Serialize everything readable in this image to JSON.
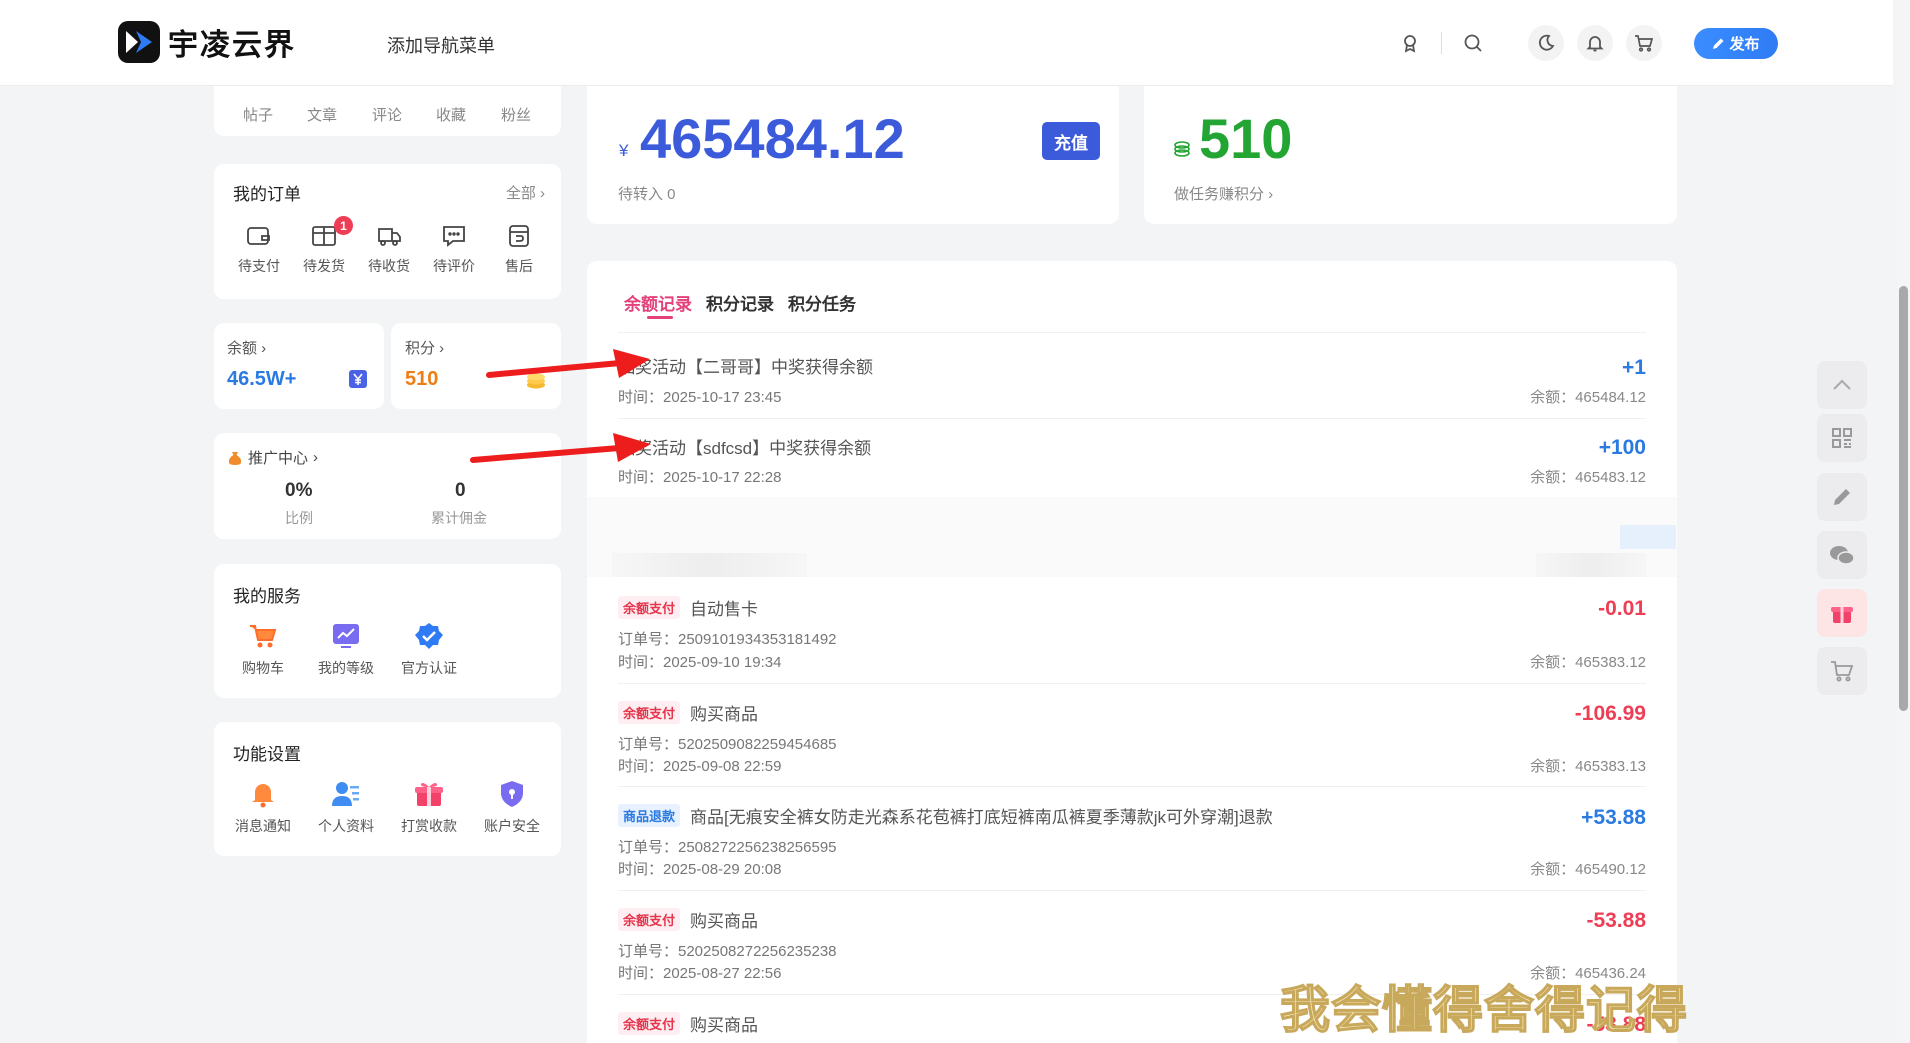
{
  "header": {
    "logo_text": "宇凌云界",
    "nav_add": "添加导航菜单",
    "publish": "发布"
  },
  "profile_stats": [
    "帖子",
    "文章",
    "评论",
    "收藏",
    "粉丝"
  ],
  "orders": {
    "title": "我的订单",
    "all": "全部",
    "badge": "1",
    "items": [
      "待支付",
      "待发货",
      "待收货",
      "待评价",
      "售后"
    ]
  },
  "mini": {
    "balance_label": "余额",
    "balance_value": "46.5W+",
    "points_label": "积分",
    "points_value": "510"
  },
  "promo": {
    "title": "推广中心",
    "ratio_value": "0%",
    "ratio_label": "比例",
    "commission_value": "0",
    "commission_label": "累计佣金"
  },
  "services": {
    "title": "我的服务",
    "items": [
      "购物车",
      "我的等级",
      "官方认证"
    ]
  },
  "settings": {
    "title": "功能设置",
    "items": [
      "消息通知",
      "个人资料",
      "打赏收款",
      "账户安全"
    ]
  },
  "balance_card": {
    "currency": "¥",
    "amount": "465484.12",
    "recharge": "充值",
    "pending": "待转入 0"
  },
  "points_card": {
    "amount": "510",
    "task_link": "做任务赚积分"
  },
  "tabs": [
    "余额记录",
    "积分记录",
    "积分任务"
  ],
  "records": [
    {
      "tag": "",
      "title": "抽奖活动【二哥哥】中奖获得余额",
      "order": "",
      "time": "时间：2025-10-17 23:45",
      "amount": "+1",
      "balance": "余额：465484.12",
      "sign": "pos"
    },
    {
      "tag": "",
      "title": "抽奖活动【sdfcsd】中奖获得余额",
      "order": "",
      "time": "时间：2025-10-17 22:28",
      "amount": "+100",
      "balance": "余额：465483.12",
      "sign": "pos"
    },
    {
      "tag": "余额支付",
      "title": "自动售卡",
      "order": "订单号：2509101934353181492",
      "time": "时间：2025-09-10 19:34",
      "amount": "-0.01",
      "balance": "余额：465383.12",
      "sign": "neg"
    },
    {
      "tag": "余额支付",
      "title": "购买商品",
      "order": "订单号：5202509082259454685",
      "time": "时间：2025-09-08 22:59",
      "amount": "-106.99",
      "balance": "余额：465383.13",
      "sign": "neg"
    },
    {
      "tag": "商品退款",
      "title": "商品[无痕安全裤女防走光森系花苞裤打底短裤南瓜裤夏季薄款jk可外穿潮]退款",
      "order": "订单号：2508272256238256595",
      "time": "时间：2025-08-29 20:08",
      "amount": "+53.88",
      "balance": "余额：465490.12",
      "sign": "pos"
    },
    {
      "tag": "余额支付",
      "title": "购买商品",
      "order": "订单号：5202508272256235238",
      "time": "时间：2025-08-27 22:56",
      "amount": "-53.88",
      "balance": "余额：465436.24",
      "sign": "neg"
    },
    {
      "tag": "余额支付",
      "title": "购买商品",
      "order": "",
      "time": "",
      "amount": "-53.88",
      "balance": "",
      "sign": "neg"
    }
  ],
  "watermark": "我会懂得舍得记得"
}
